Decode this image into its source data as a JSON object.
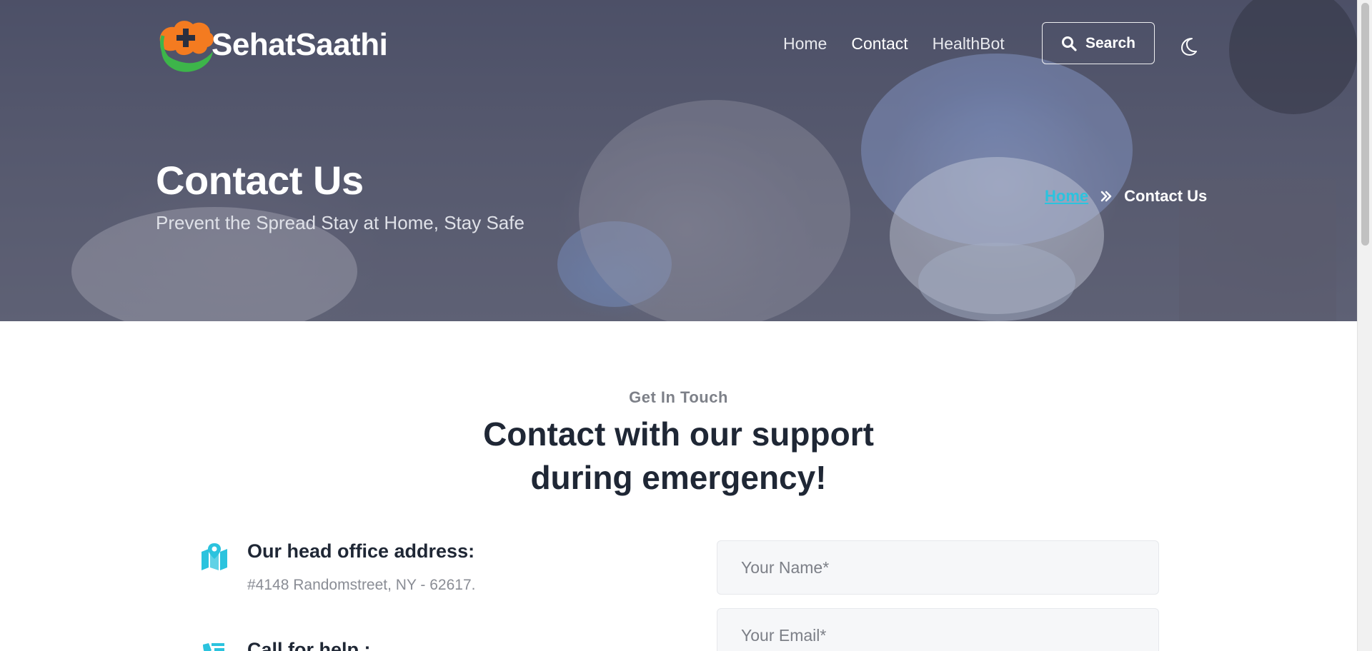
{
  "brand": {
    "name": "SehatSaathi"
  },
  "nav": {
    "items": [
      {
        "label": "Home",
        "active": false
      },
      {
        "label": "Contact",
        "active": true
      },
      {
        "label": "HealthBot",
        "active": false
      }
    ],
    "search_label": "Search"
  },
  "hero": {
    "title": "Contact Us",
    "subtitle": "Prevent the Spread Stay at Home, Stay Safe",
    "breadcrumb": {
      "home": "Home",
      "current": "Contact Us"
    }
  },
  "section": {
    "eyebrow": "Get In Touch",
    "title_line1": "Contact with our support",
    "title_line2": "during emergency!"
  },
  "contact_info": [
    {
      "icon": "map-pin-icon",
      "title": "Our head office address:",
      "value": "#4148 Randomstreet, NY - 62617."
    },
    {
      "icon": "phone-call-icon",
      "title": "Call for help :",
      "value": ""
    }
  ],
  "form": {
    "name_placeholder": "Your Name*",
    "email_placeholder": "Your Email*"
  },
  "colors": {
    "accent": "#2bc3de",
    "dark": "#1f2735",
    "logo_orange": "#f47b20",
    "logo_green": "#3db54a"
  }
}
